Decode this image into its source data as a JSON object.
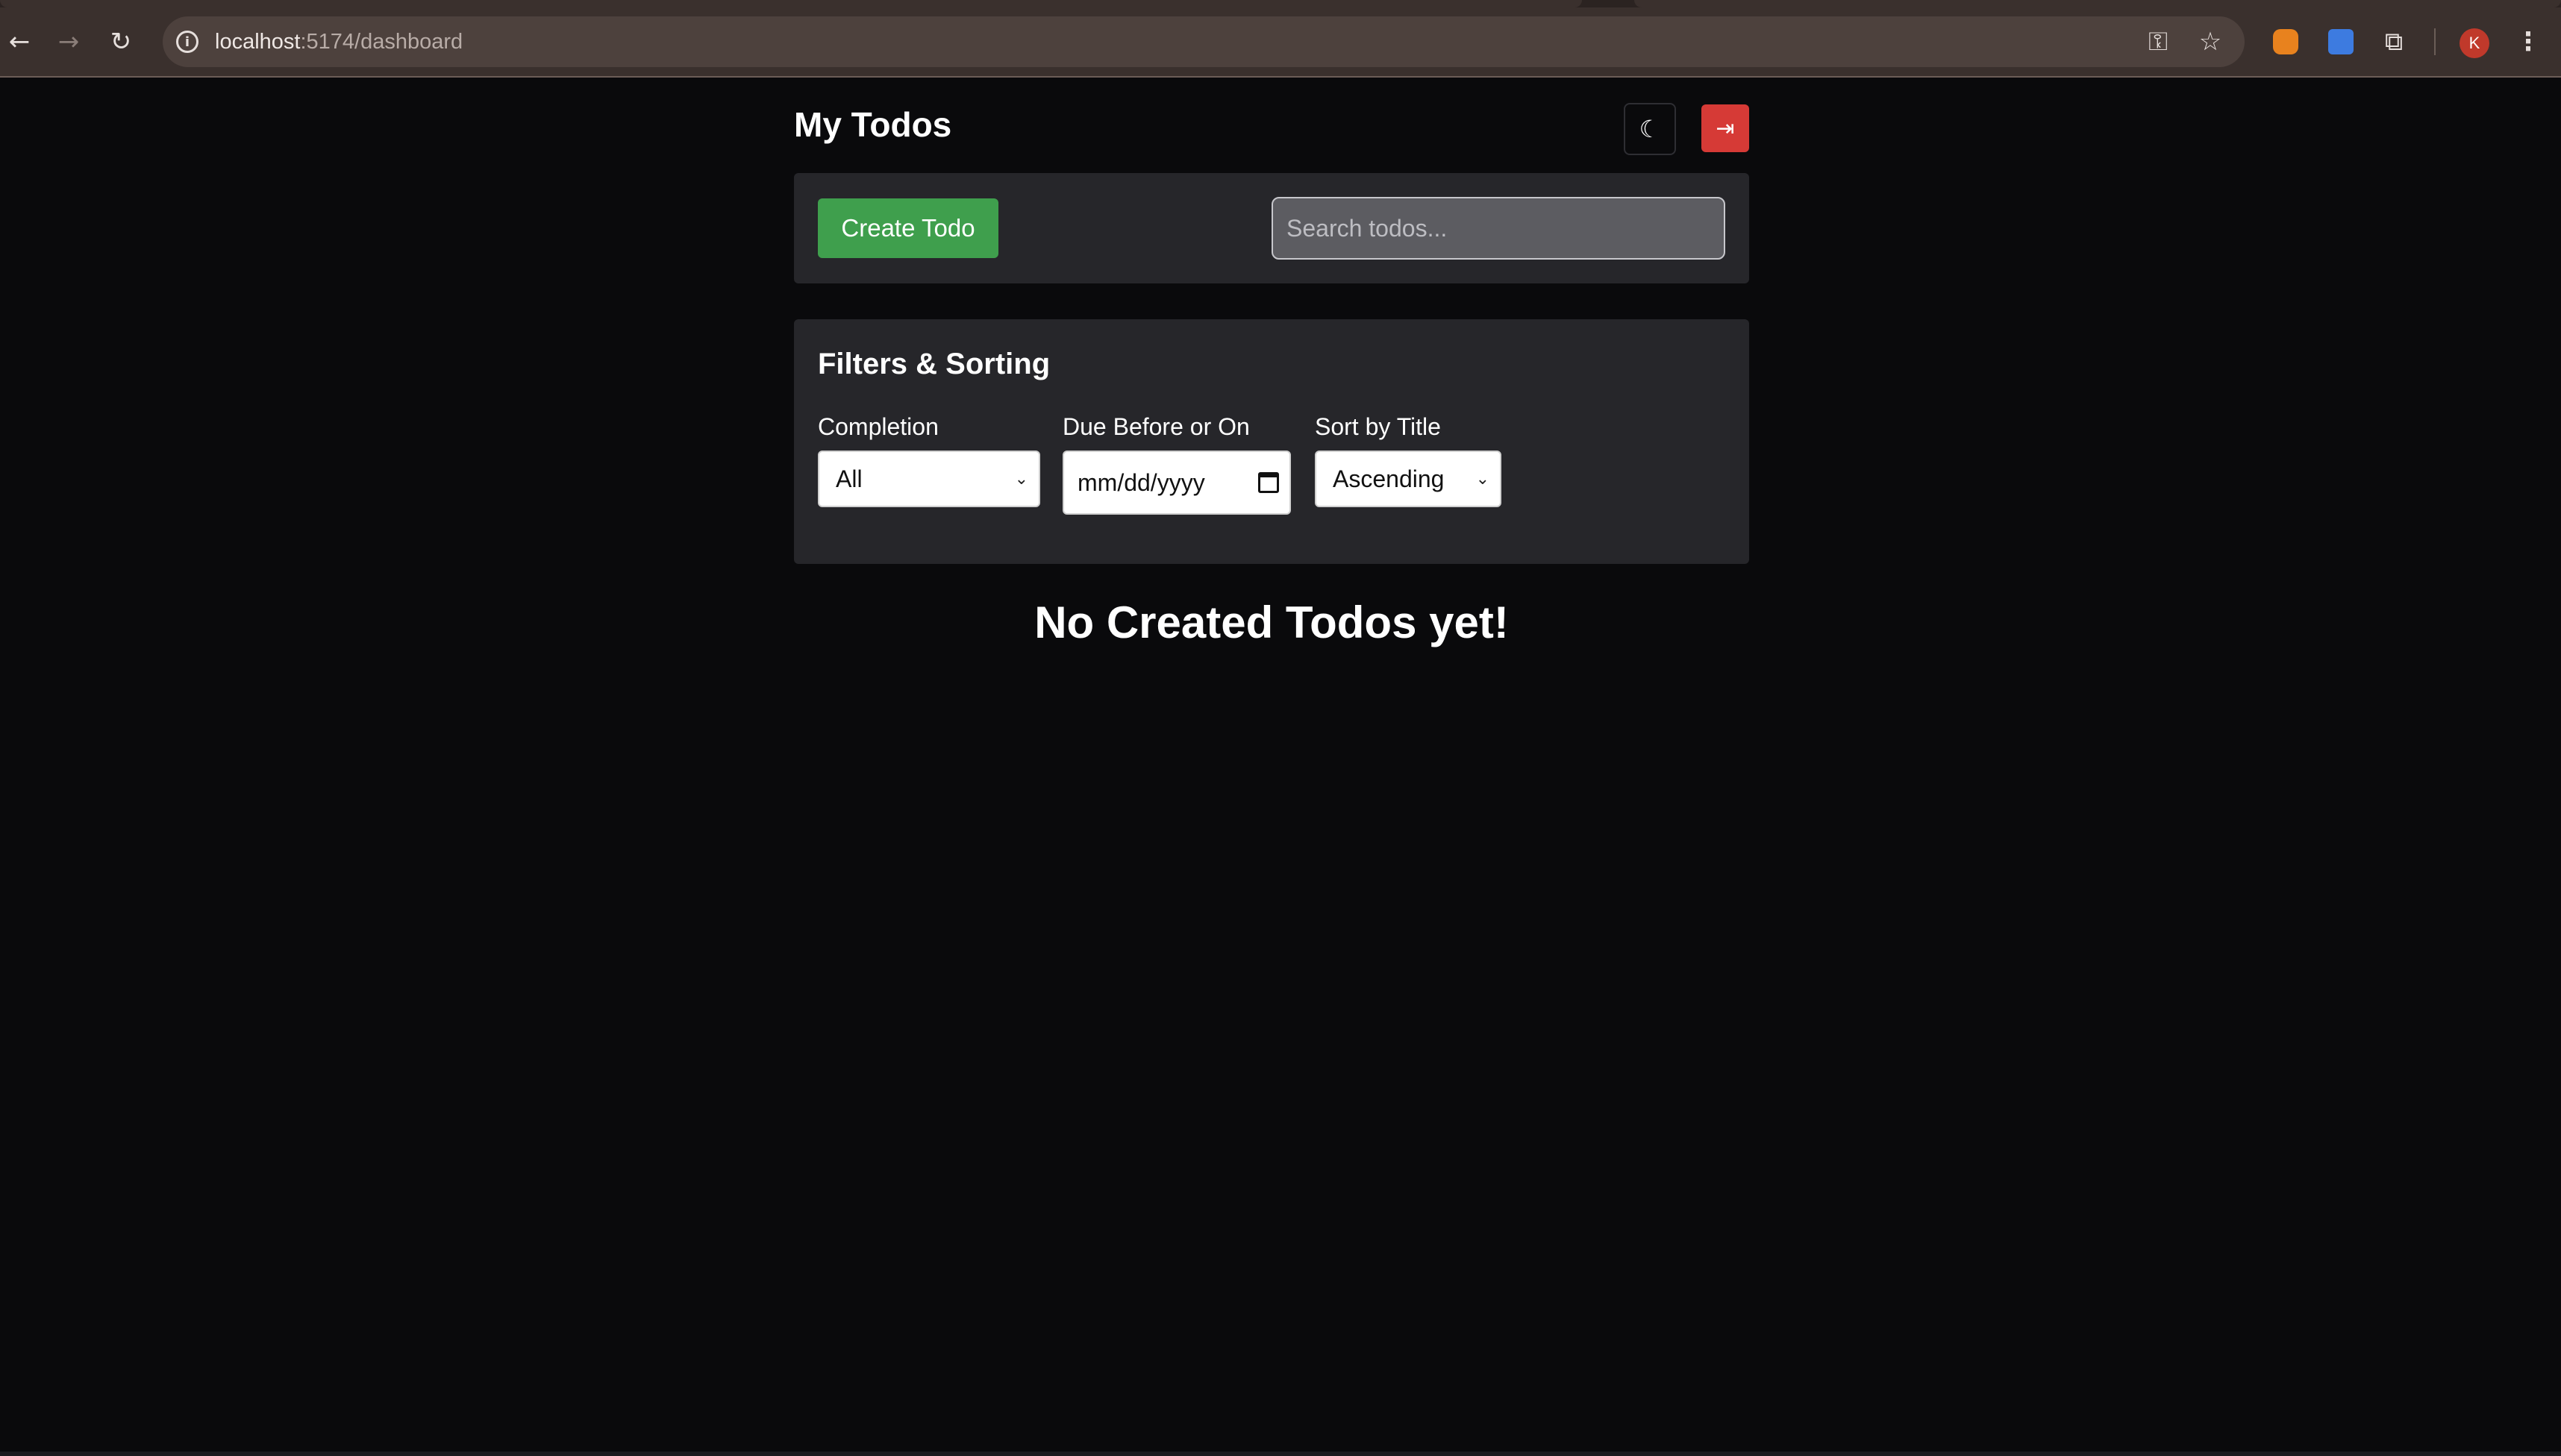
{
  "browser": {
    "url_host": "localhost",
    "url_path": ":5174/dashboard",
    "avatar_initial": "K"
  },
  "page": {
    "title": "My Todos",
    "create_label": "Create Todo",
    "search_placeholder": "Search todos...",
    "filters_title": "Filters & Sorting",
    "completion_label": "Completion",
    "completion_value": "All",
    "due_label": "Due Before or On",
    "due_placeholder": "mm/dd/yyyy",
    "sort_label": "Sort by Title",
    "sort_value": "Ascending",
    "empty_message": "No Created Todos yet!"
  },
  "colors": {
    "create_button": "#3f9f4d",
    "logout_button": "#d63a36",
    "panel": "#26262a",
    "background": "#0a0a0c"
  },
  "icons": {
    "theme": "moon-icon",
    "logout": "logout-icon",
    "date": "calendar-icon"
  }
}
